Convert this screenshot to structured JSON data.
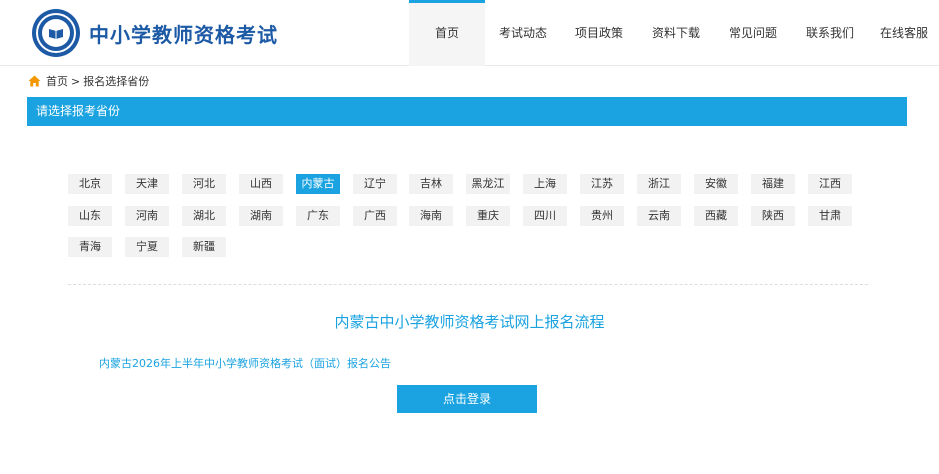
{
  "header": {
    "site_title": "中小学教师资格考试",
    "logo_icon": "emblem-book-icon",
    "nav": [
      {
        "label": "首页",
        "active": true,
        "width": 76
      },
      {
        "label": "考试动态",
        "active": false,
        "width": 76
      },
      {
        "label": "项目政策",
        "active": false,
        "width": 76
      },
      {
        "label": "资料下载",
        "active": false,
        "width": 78
      },
      {
        "label": "常见问题",
        "active": false,
        "width": 76
      },
      {
        "label": "联系我们",
        "active": false,
        "width": 78
      },
      {
        "label": "在线客服",
        "active": false,
        "width": 70
      }
    ]
  },
  "breadcrumb": {
    "home_icon": "home-icon",
    "home": "首页",
    "separator": ">",
    "current": "报名选择省份"
  },
  "section": {
    "title": "请选择报考省份"
  },
  "provinces": {
    "selected": "内蒙古",
    "rows": [
      [
        "北京",
        "天津",
        "河北",
        "山西",
        "内蒙古",
        "辽宁",
        "吉林",
        "黑龙江",
        "上海",
        "江苏",
        "浙江",
        "安徽",
        "福建",
        "江西"
      ],
      [
        "山东",
        "河南",
        "湖北",
        "湖南",
        "广东",
        "广西",
        "海南",
        "重庆",
        "四川",
        "贵州",
        "云南",
        "西藏",
        "陕西",
        "甘肃"
      ],
      [
        "青海",
        "宁夏",
        "新疆"
      ]
    ]
  },
  "process": {
    "title": "内蒙古中小学教师资格考试网上报名流程",
    "notice": "内蒙古2026年上半年中小学教师资格考试（面试）报名公告",
    "login_button": "点击登录"
  },
  "colors": {
    "brand_blue": "#1d5aa6",
    "accent": "#1aa3e0",
    "province_bg": "#f2f2f2"
  }
}
